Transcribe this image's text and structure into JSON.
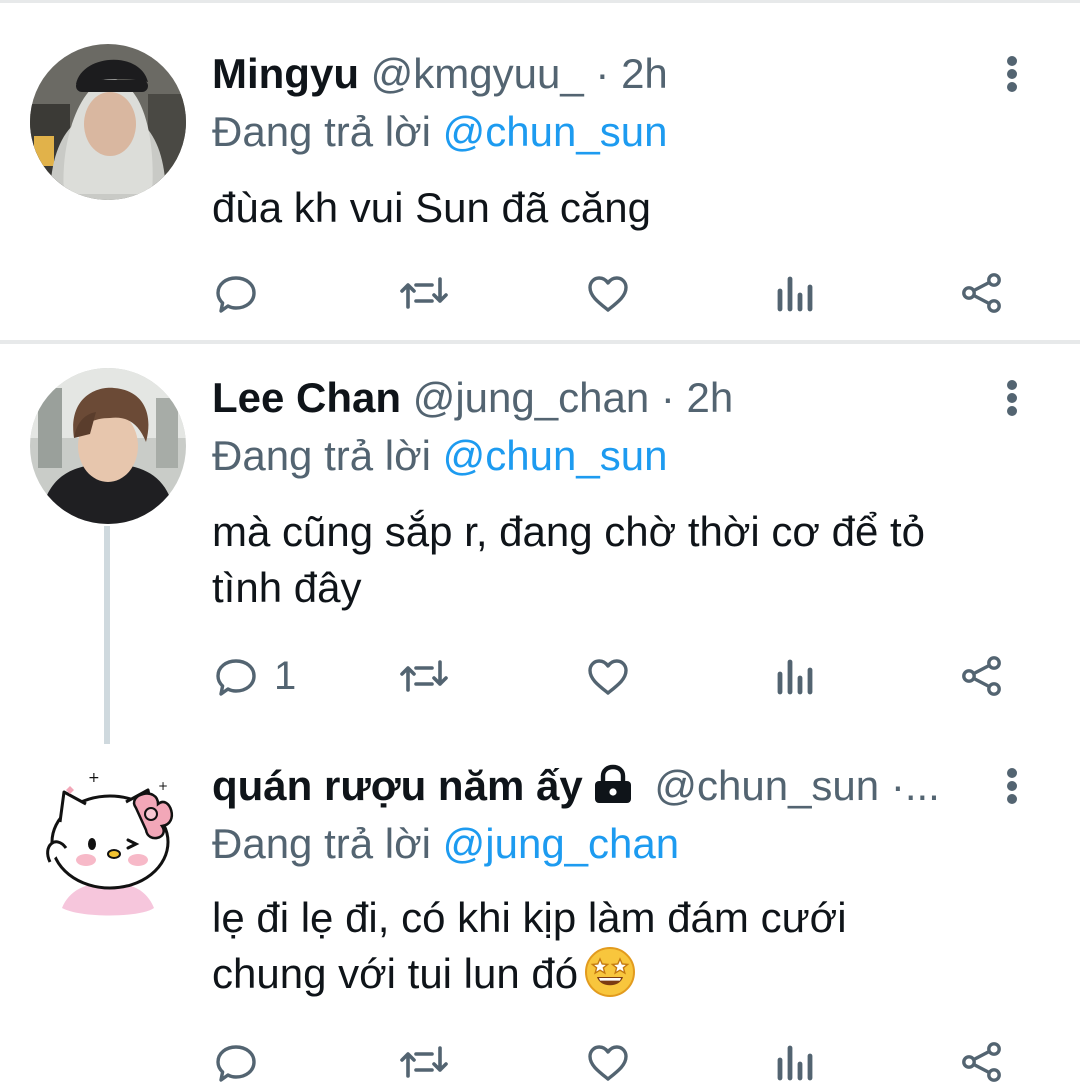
{
  "tweets": [
    {
      "name": "Mingyu",
      "handle": "@kmgyuu_",
      "dot": "·",
      "time": "2h",
      "replying_prefix": "Đang trả lời",
      "replying_to": "@chun_sun",
      "text": "đùa kh vui Sun đã căng",
      "reply_count": ""
    },
    {
      "name": "Lee Chan",
      "handle": "@jung_chan",
      "dot": "·",
      "time": "2h",
      "replying_prefix": "Đang trả lời",
      "replying_to": "@chun_sun",
      "text_line1": "mà cũng sắp r, đang chờ thời cơ để tỏ",
      "text_line2": "tình đây",
      "reply_count": "1"
    },
    {
      "name": "quán rượu năm ấy",
      "handle": "@chun_sun",
      "time_truncated": "·...",
      "replying_prefix": "Đang trả lời",
      "replying_to": "@jung_chan",
      "text_line1": "lẹ đi lẹ đi, có khi kịp làm đám cưới",
      "text_line2": "chung với tui lun đó",
      "emoji": "star-struck",
      "reply_count": ""
    }
  ],
  "icons": {
    "reply": "reply-icon",
    "retweet": "retweet-icon",
    "like": "heart-icon",
    "views": "bar-chart-icon",
    "share": "share-icon",
    "more": "more-vertical-icon",
    "lock": "lock-icon"
  },
  "colors": {
    "text_primary": "#0f1419",
    "text_secondary": "#536471",
    "link": "#1d9bf0",
    "divider": "#e7e9ea",
    "thread_line": "#cfd9de"
  }
}
